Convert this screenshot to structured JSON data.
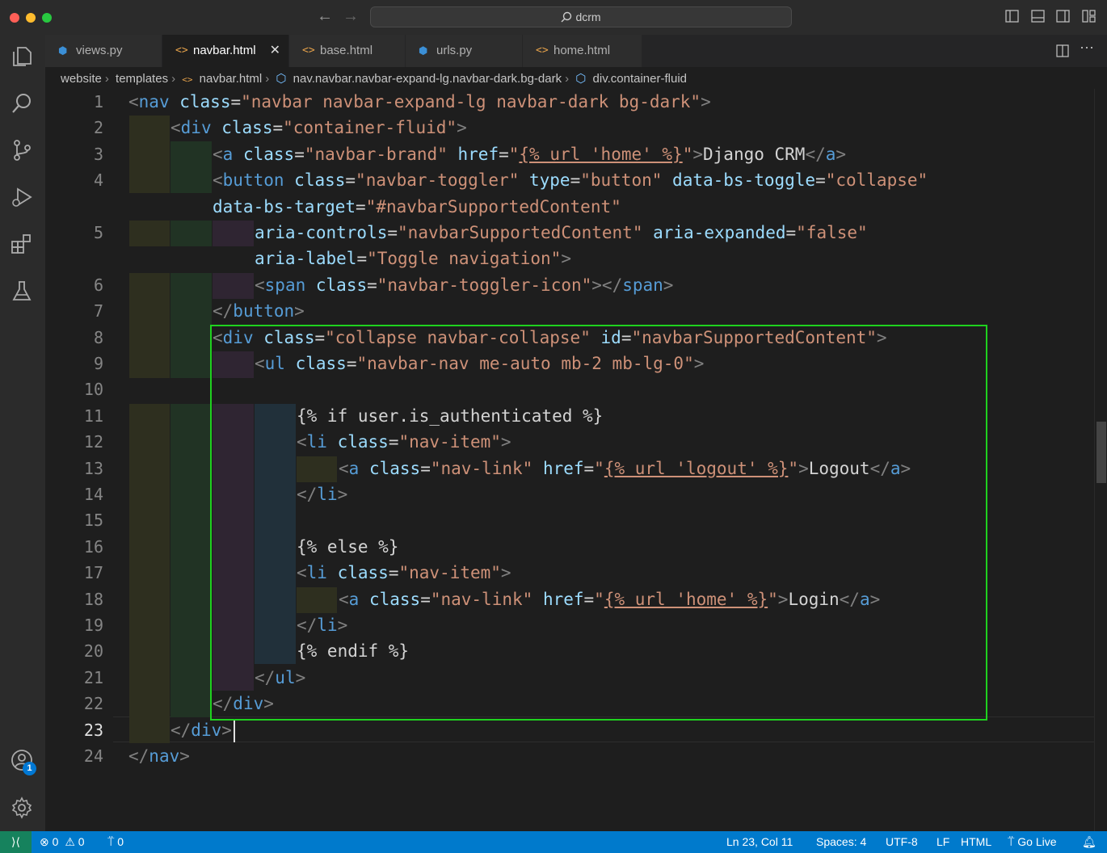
{
  "window": {
    "command_center": "dcrm",
    "back_icon": "arrow-left-icon",
    "forward_icon": "arrow-right-icon",
    "traffic_lights": [
      "#ff5f57",
      "#febc2e",
      "#28c840"
    ]
  },
  "activity_bar": {
    "items": [
      "files-icon",
      "search-icon",
      "source-control-icon",
      "run-debug-icon",
      "extensions-icon",
      "testing-icon"
    ],
    "bottom": [
      "accounts-icon",
      "settings-gear-icon"
    ],
    "accounts_badge": "1"
  },
  "tabs": [
    {
      "label": "views.py",
      "type": "py"
    },
    {
      "label": "navbar.html",
      "type": "html",
      "active": true,
      "close": "✕"
    },
    {
      "label": "base.html",
      "type": "html"
    },
    {
      "label": "urls.py",
      "type": "py"
    },
    {
      "label": "home.html",
      "type": "html"
    }
  ],
  "breadcrumbs": [
    "website",
    "templates",
    "navbar.html",
    "nav.navbar.navbar-expand-lg.navbar-dark.bg-dark",
    "div.container-fluid"
  ],
  "line_numbers": [
    "1",
    "2",
    "3",
    "4",
    "5",
    "6",
    "7",
    "8",
    "9",
    "10",
    "11",
    "12",
    "13",
    "14",
    "15",
    "16",
    "17",
    "18",
    "19",
    "20",
    "21",
    "22",
    "23",
    "24"
  ],
  "current_line": "23",
  "code": {
    "l1": {
      "open": "<",
      "tag": "nav",
      "attr": "class",
      "eq": "=",
      "val": "\"navbar navbar-expand-lg navbar-dark bg-dark\"",
      "close": ">"
    },
    "l2": {
      "open": "<",
      "tag": "div",
      "attr": "class",
      "eq": "=",
      "val": "\"container-fluid\"",
      "close": ">"
    },
    "l3": {
      "open": "<",
      "tag": "a",
      "attr1": "class",
      "val1": "\"navbar-brand\"",
      "attr2": "href",
      "q1": "\"",
      "tpl": "{% url 'home' %}",
      "q2": "\"",
      "gt": ">",
      "text": "Django CRM",
      "end": "</",
      "endtag": "a",
      "endclose": ">"
    },
    "l4": {
      "open": "<",
      "tag": "button",
      "attr1": "class",
      "val1": "\"navbar-toggler\"",
      "attr2": "type",
      "val2": "\"button\"",
      "attr3": "data-bs-toggle",
      "val3": "\"collapse\""
    },
    "l4b": {
      "attr": "data-bs-target",
      "val": "\"#navbarSupportedContent\""
    },
    "l5": {
      "attr1": "aria-controls",
      "val1": "\"navbarSupportedContent\"",
      "attr2": "aria-expanded",
      "val2": "\"false\""
    },
    "l5b": {
      "attr": "aria-label",
      "val": "\"Toggle navigation\"",
      "close": ">"
    },
    "l6": {
      "open": "<",
      "tag": "span",
      "attr": "class",
      "val": "\"navbar-toggler-icon\"",
      "mid": "></",
      "endtag": "span",
      "close": ">"
    },
    "l7": {
      "open": "</",
      "tag": "button",
      "close": ">"
    },
    "l8": {
      "open": "<",
      "tag": "div",
      "attr1": "class",
      "val1": "\"collapse navbar-collapse\"",
      "attr2": "id",
      "val2": "\"navbarSupportedContent\"",
      "close": ">"
    },
    "l9": {
      "open": "<",
      "tag": "ul",
      "attr": "class",
      "val": "\"navbar-nav me-auto mb-2 mb-lg-0\"",
      "close": ">"
    },
    "l11": {
      "text": "{% if user.is_authenticated %}"
    },
    "l12": {
      "open": "<",
      "tag": "li",
      "attr": "class",
      "val": "\"nav-item\"",
      "close": ">"
    },
    "l13": {
      "open": "<",
      "tag": "a",
      "attr1": "class",
      "val1": "\"nav-link\"",
      "attr2": "href",
      "q1": "\"",
      "tpl": "{% url 'logout' %}",
      "q2": "\"",
      "gt": ">",
      "text": "Logout",
      "end": "</",
      "endtag": "a",
      "endclose": ">"
    },
    "l14": {
      "open": "</",
      "tag": "li",
      "close": ">"
    },
    "l16": {
      "text": "{% else %}"
    },
    "l17": {
      "open": "<",
      "tag": "li",
      "attr": "class",
      "val": "\"nav-item\"",
      "close": ">"
    },
    "l18": {
      "open": "<",
      "tag": "a",
      "attr1": "class",
      "val1": "\"nav-link\"",
      "attr2": "href",
      "q1": "\"",
      "tpl": "{% url 'home' %}",
      "q2": "\"",
      "gt": ">",
      "text": "Login",
      "end": "</",
      "endtag": "a",
      "endclose": ">"
    },
    "l19": {
      "open": "</",
      "tag": "li",
      "close": ">"
    },
    "l20": {
      "text": "{% endif %}"
    },
    "l21": {
      "open": "</",
      "tag": "ul",
      "close": ">"
    },
    "l22": {
      "open": "</",
      "tag": "div",
      "close": ">"
    },
    "l23": {
      "open": "</",
      "tag": "div",
      "close": ">"
    },
    "l24": {
      "open": "</",
      "tag": "nav",
      "close": ">"
    }
  },
  "status": {
    "errors": "0",
    "warnings": "0",
    "ports": "0",
    "position": "Ln 23, Col 11",
    "spaces": "Spaces: 4",
    "encoding": "UTF-8",
    "eol": "LF",
    "language": "HTML",
    "golive": "Go Live"
  },
  "colors": {
    "highlight_box": "#1fd11f",
    "status_bar": "#007acc",
    "remote": "#16825d"
  }
}
